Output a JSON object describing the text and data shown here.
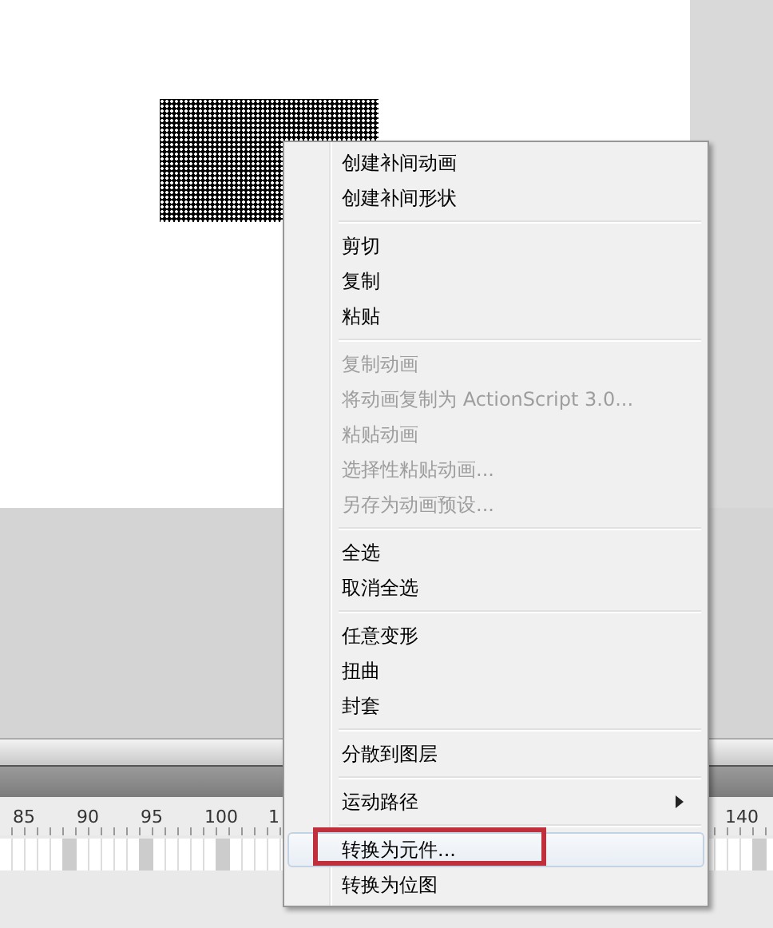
{
  "menu": {
    "groups": [
      {
        "items": [
          {
            "label": "创建补间动画",
            "disabled": false,
            "selected": false,
            "submenu": false,
            "annotated": false
          },
          {
            "label": "创建补间形状",
            "disabled": false,
            "selected": false,
            "submenu": false,
            "annotated": false
          }
        ]
      },
      {
        "items": [
          {
            "label": "剪切",
            "disabled": false,
            "selected": false,
            "submenu": false,
            "annotated": false
          },
          {
            "label": "复制",
            "disabled": false,
            "selected": false,
            "submenu": false,
            "annotated": false
          },
          {
            "label": "粘贴",
            "disabled": false,
            "selected": false,
            "submenu": false,
            "annotated": false
          }
        ]
      },
      {
        "items": [
          {
            "label": "复制动画",
            "disabled": true,
            "selected": false,
            "submenu": false,
            "annotated": false
          },
          {
            "label": "将动画复制为 ActionScript 3.0...",
            "disabled": true,
            "selected": false,
            "submenu": false,
            "annotated": false
          },
          {
            "label": "粘贴动画",
            "disabled": true,
            "selected": false,
            "submenu": false,
            "annotated": false
          },
          {
            "label": "选择性粘贴动画...",
            "disabled": true,
            "selected": false,
            "submenu": false,
            "annotated": false
          },
          {
            "label": "另存为动画预设...",
            "disabled": true,
            "selected": false,
            "submenu": false,
            "annotated": false
          }
        ]
      },
      {
        "items": [
          {
            "label": "全选",
            "disabled": false,
            "selected": false,
            "submenu": false,
            "annotated": false
          },
          {
            "label": "取消全选",
            "disabled": false,
            "selected": false,
            "submenu": false,
            "annotated": false
          }
        ]
      },
      {
        "items": [
          {
            "label": "任意变形",
            "disabled": false,
            "selected": false,
            "submenu": false,
            "annotated": false
          },
          {
            "label": "扭曲",
            "disabled": false,
            "selected": false,
            "submenu": false,
            "annotated": false
          },
          {
            "label": "封套",
            "disabled": false,
            "selected": false,
            "submenu": false,
            "annotated": false
          }
        ]
      },
      {
        "items": [
          {
            "label": "分散到图层",
            "disabled": false,
            "selected": false,
            "submenu": false,
            "annotated": false
          }
        ]
      },
      {
        "items": [
          {
            "label": "运动路径",
            "disabled": false,
            "selected": false,
            "submenu": true,
            "annotated": false
          }
        ]
      },
      {
        "items": [
          {
            "label": "转换为元件...",
            "disabled": false,
            "selected": true,
            "submenu": false,
            "annotated": true
          },
          {
            "label": "转换为位图",
            "disabled": false,
            "selected": false,
            "submenu": false,
            "annotated": false
          }
        ]
      }
    ]
  },
  "timeline": {
    "ruler_labels": [
      "85",
      "90",
      "95",
      "100",
      "1",
      "140"
    ]
  }
}
